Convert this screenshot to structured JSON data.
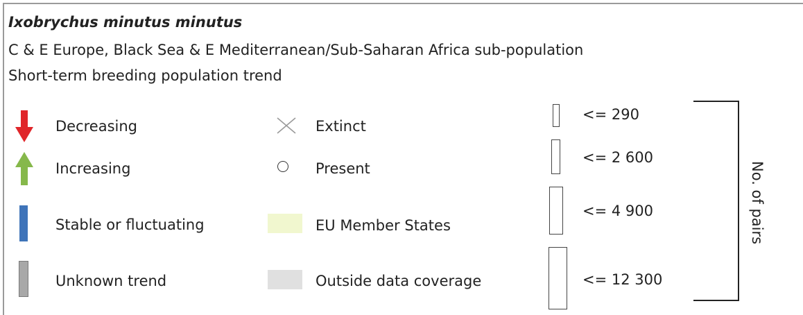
{
  "title": "Ixobrychus minutus minutus",
  "subtitle_population": "C & E Europe, Black Sea & E Mediterranean/Sub-Saharan Africa sub-population",
  "subtitle_trend": "Short-term breeding population trend",
  "trend_legend": [
    {
      "label": "Decreasing",
      "icon": "red-down-arrow-icon",
      "color": "#e0262a"
    },
    {
      "label": "Increasing",
      "icon": "green-up-arrow-icon",
      "color": "#86b84b"
    },
    {
      "label": "Stable or fluctuating",
      "icon": "blue-bar-icon",
      "color": "#3f74b9"
    },
    {
      "label": "Unknown trend",
      "icon": "grey-bar-icon",
      "color": "#a8a8a8"
    }
  ],
  "status_legend": [
    {
      "label": "Extinct",
      "icon": "cross-icon"
    },
    {
      "label": "Present",
      "icon": "circle-icon"
    },
    {
      "label": "EU Member States",
      "icon": "eu-swatch",
      "color": "#f1f7cf"
    },
    {
      "label": "Outside data coverage",
      "icon": "outside-swatch",
      "color": "#e0e0e0"
    }
  ],
  "size_legend": {
    "classes": [
      "<= 290",
      "<= 2 600",
      "<= 4 900",
      "<= 12 300"
    ],
    "label": "No. of pairs"
  }
}
